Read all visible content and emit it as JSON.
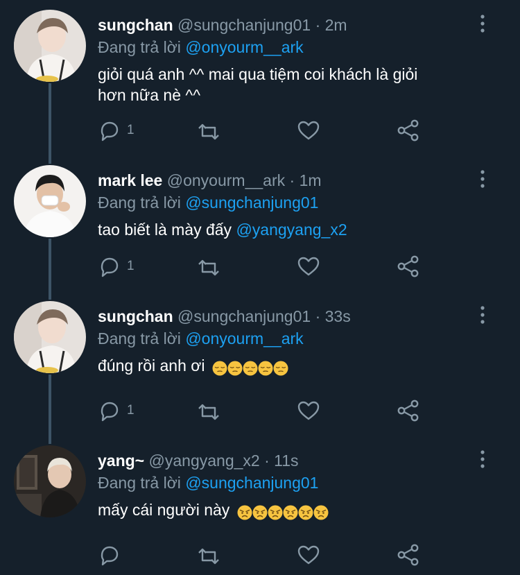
{
  "colors": {
    "background": "#15202b",
    "secondary_text": "#8899a6",
    "mention": "#1da1f2",
    "thread_line": "#3d5466"
  },
  "tweets": [
    {
      "name": "sungchan",
      "handle": "@sungchanjung01",
      "time": "· 2m",
      "replying_prefix": "Đang trả lời",
      "replying_to": "@onyourm__ark",
      "text_line1": "giỏi quá anh ^^ mai qua tiệm coi khách là giỏi",
      "text_line2": "hơn nữa nè ^^",
      "reply_count": "1",
      "icons": [
        "reply-icon",
        "retweet-icon",
        "like-icon",
        "share-icon"
      ]
    },
    {
      "name": "mark lee",
      "handle": "@onyourm__ark",
      "time": "· 1m",
      "replying_prefix": "Đang trả lời",
      "replying_to": "@sungchanjung01",
      "text": "tao biết là mày đấy",
      "text_mention": "@yangyang_x2",
      "reply_count": "1"
    },
    {
      "name": "sungchan",
      "handle": "@sungchanjung01",
      "time": "· 33s",
      "replying_prefix": "Đang trả lời",
      "replying_to": "@onyourm__ark",
      "text": "đúng rồi anh ơi",
      "emoji": "pensive-face",
      "emoji_count": 5,
      "reply_count": "1"
    },
    {
      "name": "yang~",
      "handle": "@yangyang_x2",
      "time": "· 11s",
      "replying_prefix": "Đang trả lời",
      "replying_to": "@sungchanjung01",
      "text": "mấy cái người này",
      "emoji": "angry-face",
      "emoji_count": 6,
      "reply_count": ""
    }
  ]
}
